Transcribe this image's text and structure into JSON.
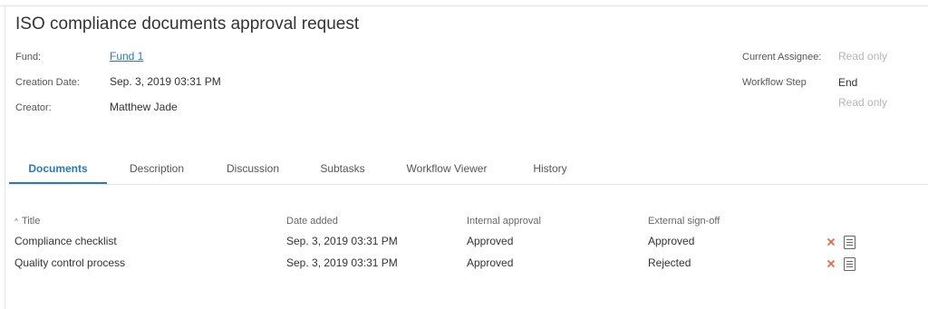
{
  "page": {
    "title": "ISO compliance documents approval request"
  },
  "details": {
    "fund_label": "Fund:",
    "fund_value": "Fund 1",
    "creation_date_label": "Creation Date:",
    "creation_date_value": "Sep. 3, 2019 03:31 PM",
    "creator_label": "Creator:",
    "creator_value": "Matthew Jade",
    "current_assignee_label": "Current Assignee:",
    "current_assignee_value": "Read only",
    "workflow_step_label": "Workflow Step",
    "workflow_step_value": "End",
    "workflow_step_note": "Read only"
  },
  "tabs": [
    {
      "label": "Documents",
      "active": true
    },
    {
      "label": "Description"
    },
    {
      "label": "Discussion"
    },
    {
      "label": "Subtasks"
    },
    {
      "label": "Workflow Viewer"
    },
    {
      "label": "History"
    }
  ],
  "table": {
    "headers": {
      "sort_indicator": "^",
      "title": "Title",
      "date_added": "Date added",
      "internal_approval": "Internal approval",
      "external_signoff": "External sign-off"
    },
    "rows": [
      {
        "title": "Compliance checklist",
        "date_added": "Sep. 3, 2019 03:31 PM",
        "internal_approval": "Approved",
        "external_signoff": "Approved"
      },
      {
        "title": "Quality control process",
        "date_added": "Sep. 3, 2019 03:31 PM",
        "internal_approval": "Approved",
        "external_signoff": "Rejected"
      }
    ],
    "row_actions": [
      "close-icon",
      "document-icon"
    ]
  },
  "colors": {
    "accent": "#2a7ab8",
    "remove": "#e8643c",
    "muted": "#b5b5b5"
  }
}
